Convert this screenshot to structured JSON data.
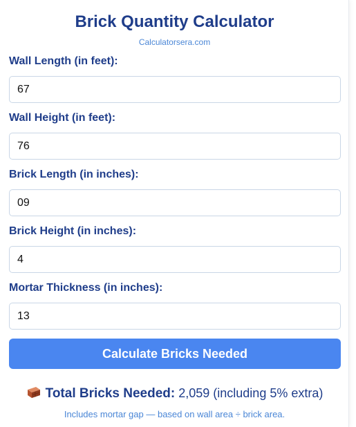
{
  "header": {
    "title": "Brick Quantity Calculator",
    "subtitle": "Calculatorsera.com"
  },
  "fields": [
    {
      "label": "Wall Length (in feet):",
      "value": "67"
    },
    {
      "label": "Wall Height (in feet):",
      "value": "76"
    },
    {
      "label": "Brick Length (in inches):",
      "value": "09"
    },
    {
      "label": "Brick Height (in inches):",
      "value": "4"
    },
    {
      "label": "Mortar Thickness (in inches):",
      "value": "13"
    }
  ],
  "button": {
    "label": "Calculate Bricks Needed"
  },
  "result": {
    "icon": "brick-icon",
    "label": "Total Bricks Needed:",
    "value": "2,059 (including 5% extra)"
  },
  "note": "Includes mortar gap — based on wall area ÷ brick area.",
  "colors": {
    "heading": "#1f3d8a",
    "accent": "#4a86f0",
    "link": "#4a86d6"
  }
}
